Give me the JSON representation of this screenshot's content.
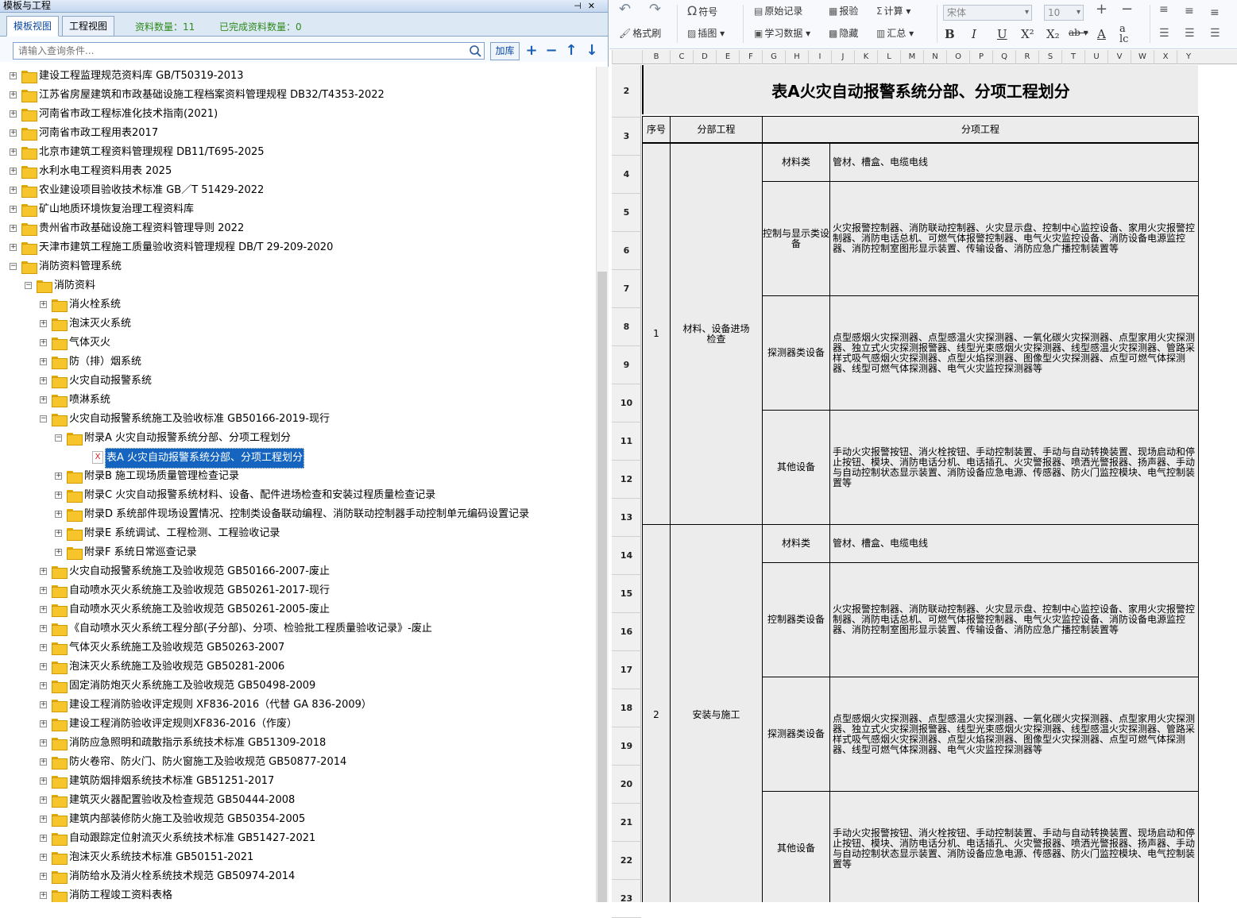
{
  "panel": {
    "title": "模板与工程"
  },
  "tabs": [
    {
      "label": "模板视图"
    },
    {
      "label": "工程视图"
    }
  ],
  "stats": {
    "count": "资料数量：11",
    "done": "已完成资料数量：0"
  },
  "search": {
    "placeholder": "请输入查询条件...",
    "add_label": "加库"
  },
  "tree": [
    {
      "label": "建设工程监理规范资料库 GB/T50319-2013",
      "level": 0,
      "expanded": false
    },
    {
      "label": "江苏省房屋建筑和市政基础设施工程档案资料管理规程 DB32/T4353-2022",
      "level": 0,
      "expanded": false
    },
    {
      "label": "河南省市政工程标准化技术指南(2021)",
      "level": 0,
      "expanded": false
    },
    {
      "label": "河南省市政工程用表2017",
      "level": 0,
      "expanded": false
    },
    {
      "label": "北京市建筑工程资料管理规程 DB11/T695-2025",
      "level": 0,
      "expanded": false
    },
    {
      "label": "水利水电工程资料用表 2025",
      "level": 0,
      "expanded": false
    },
    {
      "label": "农业建设项目验收技术标准 GB／T 51429-2022",
      "level": 0,
      "expanded": false
    },
    {
      "label": "矿山地质环境恢复治理工程资料库",
      "level": 0,
      "expanded": false
    },
    {
      "label": "贵州省市政基础设施工程资料管理导则 2022",
      "level": 0,
      "expanded": false
    },
    {
      "label": "天津市建筑工程施工质量验收资料管理规程 DB/T 29-209-2020",
      "level": 0,
      "expanded": false
    },
    {
      "label": "消防资料管理系统",
      "level": 0,
      "expanded": true
    },
    {
      "label": "消防资料",
      "level": 1,
      "expanded": true
    },
    {
      "label": "消火栓系统",
      "level": 2,
      "expanded": false
    },
    {
      "label": "泡沫灭火系统",
      "level": 2,
      "expanded": false
    },
    {
      "label": "气体灭火",
      "level": 2,
      "expanded": false
    },
    {
      "label": "防（排）烟系统",
      "level": 2,
      "expanded": false
    },
    {
      "label": "火灾自动报警系统",
      "level": 2,
      "expanded": false
    },
    {
      "label": "喷淋系统",
      "level": 2,
      "expanded": false
    },
    {
      "label": "火灾自动报警系统施工及验收标准 GB50166-2019-现行",
      "level": 2,
      "expanded": true
    },
    {
      "label": "附录A 火灾自动报警系统分部、分项工程划分",
      "level": 3,
      "expanded": true
    },
    {
      "label": "表A 火灾自动报警系统分部、分项工程划分",
      "level": 4,
      "file": true,
      "selected": true
    },
    {
      "label": "附录B 施工现场质量管理检查记录",
      "level": 3,
      "expanded": false
    },
    {
      "label": "附录C 火灾自动报警系统材料、设备、配件进场检查和安装过程质量检查记录",
      "level": 3,
      "expanded": false
    },
    {
      "label": "附录D 系统部件现场设置情况、控制类设备联动编程、消防联动控制器手动控制单元编码设置记录",
      "level": 3,
      "expanded": false
    },
    {
      "label": "附录E 系统调试、工程检测、工程验收记录",
      "level": 3,
      "expanded": false
    },
    {
      "label": "附录F 系统日常巡查记录",
      "level": 3,
      "expanded": false
    },
    {
      "label": "火灾自动报警系统施工及验收规范 GB50166-2007-废止",
      "level": 2,
      "expanded": false
    },
    {
      "label": "自动喷水灭火系统施工及验收规范 GB50261-2017-现行",
      "level": 2,
      "expanded": false
    },
    {
      "label": "自动喷水灭火系统施工及验收规范 GB50261-2005-废止",
      "level": 2,
      "expanded": false
    },
    {
      "label": "《自动喷水灭火系统工程分部(子分部)、分项、检验批工程质量验收记录》-废止",
      "level": 2,
      "expanded": false
    },
    {
      "label": "气体灭火系统施工及验收规范 GB50263-2007",
      "level": 2,
      "expanded": false
    },
    {
      "label": "泡沫灭火系统施工及验收规范 GB50281-2006",
      "level": 2,
      "expanded": false
    },
    {
      "label": "固定消防炮灭火系统施工及验收规范 GB50498-2009",
      "level": 2,
      "expanded": false
    },
    {
      "label": "建设工程消防验收评定规则 XF836-2016（代替 GA 836-2009）",
      "level": 2,
      "expanded": false
    },
    {
      "label": "建设工程消防验收评定规则XF836-2016（作废）",
      "level": 2,
      "expanded": false
    },
    {
      "label": "消防应急照明和疏散指示系统技术标准 GB51309-2018",
      "level": 2,
      "expanded": false
    },
    {
      "label": "防火卷帘、防火门、防火窗施工及验收规范 GB50877-2014",
      "level": 2,
      "expanded": false
    },
    {
      "label": "建筑防烟排烟系统技术标准 GB51251-2017",
      "level": 2,
      "expanded": false
    },
    {
      "label": "建筑灭火器配置验收及检查规范 GB50444-2008",
      "level": 2,
      "expanded": false
    },
    {
      "label": "建筑内部装修防火施工及验收规范 GB50354-2005",
      "level": 2,
      "expanded": false
    },
    {
      "label": "自动跟踪定位射流灭火系统技术标准 GB51427-2021",
      "level": 2,
      "expanded": false
    },
    {
      "label": "泡沫灭火系统技术标准 GB50151-2021",
      "level": 2,
      "expanded": false
    },
    {
      "label": "消防给水及消火栓系统技术规范 GB50974-2014",
      "level": 2,
      "expanded": false
    },
    {
      "label": "消防工程竣工资料表格",
      "level": 2,
      "expanded": false
    }
  ],
  "toolbar": {
    "symbol": "符号",
    "format_brush": "格式刷",
    "insert_image": "插图",
    "original_record": "原始记录",
    "report": "报验",
    "calc": "计算",
    "learn_data": "学习数据",
    "hide": "隐藏",
    "summary": "汇总",
    "font_name": "宋体",
    "font_size": "10"
  },
  "columns": [
    "B",
    "C",
    "D",
    "E",
    "F",
    "G",
    "H",
    "I",
    "J",
    "K",
    "L",
    "M",
    "N",
    "O",
    "P",
    "Q",
    "R",
    "S",
    "T",
    "U",
    "V",
    "W",
    "X",
    "Y"
  ],
  "rows": [
    "2",
    "3",
    "4",
    "5",
    "6",
    "7",
    "8",
    "9",
    "10",
    "11",
    "12",
    "13",
    "14",
    "15",
    "16",
    "17",
    "18",
    "19",
    "20",
    "21",
    "22",
    "23"
  ],
  "sheet": {
    "title": "表A火灾自动报警系统分部、分项工程划分",
    "headers": {
      "no": "序号",
      "division": "分部工程",
      "subdivision": "分项工程"
    },
    "groups": [
      {
        "no": "1",
        "division": "材料、设备进场检查",
        "items": [
          {
            "name": "材料类",
            "content": "管材、槽盒、电缆电线"
          },
          {
            "name": "控制与显示类设备",
            "content": "火灾报警控制器、消防联动控制器、火灾显示盘、控制中心监控设备、家用火灾报警控制器、消防电话总机、可燃气体报警控制器、电气火灾监控设备、消防设备电源监控器、消防控制室图形显示装置、传输设备、消防应急广播控制装置等"
          },
          {
            "name": "探测器类设备",
            "content": "点型感烟火灾探测器、点型感温火灾探测器、一氧化碳火灾探测器、点型家用火灾探测器、独立式火灾探测报警器、线型光束感烟火灾探测器、线型感温火灾探测器、管路采样式吸气感烟火灾探测器、点型火焰探测器、图像型火灾探测器、点型可燃气体探测器、线型可燃气体探测器、电气火灾监控探测器等"
          },
          {
            "name": "其他设备",
            "content": "手动火灾报警按钮、消火栓按钮、手动控制装置、手动与自动转换装置、现场启动和停止按钮、模块、消防电话分机、电话插孔、火灾警报器、喷洒光警报器、扬声器、手动与自动控制状态显示装置、消防设备应急电源、传感器、防火门监控模块、电气控制装置等"
          }
        ]
      },
      {
        "no": "2",
        "division": "安装与施工",
        "items": [
          {
            "name": "材料类",
            "content": "管材、槽盒、电缆电线"
          },
          {
            "name": "控制器类设备",
            "content": "火灾报警控制器、消防联动控制器、火灾显示盘、控制中心监控设备、家用火灾报警控制器、消防电话总机、可燃气体报警控制器、电气火灾监控设备、消防设备电源监控器、消防控制室图形显示装置、传输设备、消防应急广播控制装置等"
          },
          {
            "name": "探测器类设备",
            "content": "点型感烟火灾探测器、点型感温火灾探测器、一氧化碳火灾探测器、点型家用火灾探测器、独立式火灾探测报警器、线型光束感烟火灾探测器、线型感温火灾探测器、管路采样式吸气感烟火灾探测器、点型火焰探测器、图像型火灾探测器、点型可燃气体探测器、线型可燃气体探测器、电气火灾监控探测器等"
          },
          {
            "name": "其他设备",
            "content": "手动火灾报警按钮、消火栓按钮、手动控制装置、手动与自动转换装置、现场启动和停止按钮、模块、消防电话分机、电话插孔、火灾警报器、喷洒光警报器、扬声器、手动与自动控制状态显示装置、消防设备应急电源、传感器、防火门监控模块、电气控制装置等"
          }
        ]
      }
    ]
  }
}
